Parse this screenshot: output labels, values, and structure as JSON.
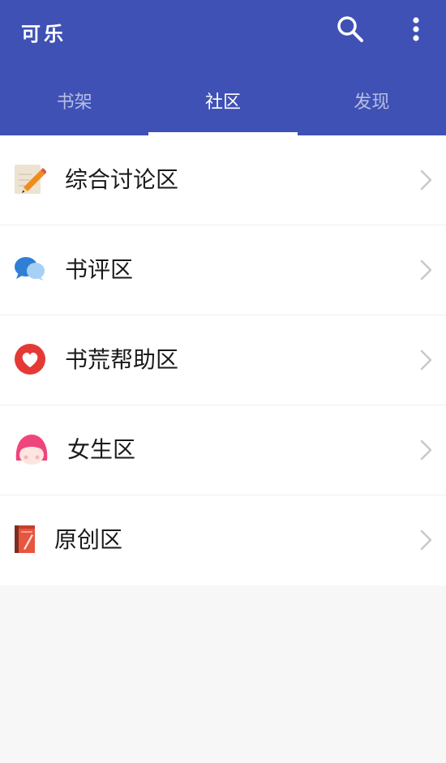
{
  "app": {
    "title": "可乐",
    "actions": [
      "search-icon",
      "more-vert-icon"
    ]
  },
  "tabs": [
    {
      "label": "书架",
      "active": false
    },
    {
      "label": "社区",
      "active": true
    },
    {
      "label": "发现",
      "active": false
    }
  ],
  "community": {
    "items": [
      {
        "label": "综合讨论区",
        "icon": "pencil-notepad-icon"
      },
      {
        "label": "书评区",
        "icon": "chat-bubbles-icon"
      },
      {
        "label": "书荒帮助区",
        "icon": "heart-icon"
      },
      {
        "label": "女生区",
        "icon": "girl-face-icon"
      },
      {
        "label": "原创区",
        "icon": "book-icon"
      }
    ]
  },
  "colors": {
    "primary": "#3f51b5",
    "tab_indicator": "#ffffff",
    "chevron": "#c8c8c8",
    "background": "#f7f7f7"
  }
}
